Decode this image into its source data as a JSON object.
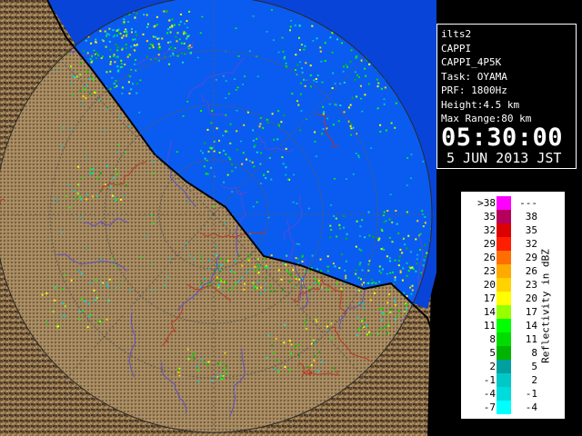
{
  "info": {
    "site": "ilts2",
    "product": "CAPPI",
    "product_code": "CAPPI_4P5K",
    "task": "Task: OYAMA",
    "prf": "PRF: 1800Hz",
    "height": "Height:4.5 km",
    "max_range": "Max Range:80 km",
    "time": "05:30:00",
    "date": "5 JUN 2013 JST"
  },
  "legend": {
    "title": "Reflectivity in dBZ",
    "rows": [
      {
        "lo": ">38",
        "hi": "---",
        "color": "#ff00ff"
      },
      {
        "lo": "35",
        "hi": "38",
        "color": "#b4005a"
      },
      {
        "lo": "32",
        "hi": "35",
        "color": "#dc0000"
      },
      {
        "lo": "29",
        "hi": "32",
        "color": "#ff1e00"
      },
      {
        "lo": "26",
        "hi": "29",
        "color": "#ff6e00"
      },
      {
        "lo": "23",
        "hi": "26",
        "color": "#ffaa00"
      },
      {
        "lo": "20",
        "hi": "23",
        "color": "#ffd200"
      },
      {
        "lo": "17",
        "hi": "20",
        "color": "#ffff00"
      },
      {
        "lo": "14",
        "hi": "17",
        "color": "#96ff00"
      },
      {
        "lo": "11",
        "hi": "14",
        "color": "#00ff00"
      },
      {
        "lo": "8",
        "hi": "11",
        "color": "#00dc00"
      },
      {
        "lo": "5",
        "hi": "8",
        "color": "#00b400"
      },
      {
        "lo": "2",
        "hi": "5",
        "color": "#00a0a0"
      },
      {
        "lo": "-1",
        "hi": "2",
        "color": "#00c8c8"
      },
      {
        "lo": "-4",
        "hi": "-1",
        "color": "#00dcdc"
      },
      {
        "lo": "-7",
        "hi": "-4",
        "color": "#00ffff"
      }
    ]
  },
  "map": {
    "sea_color": "#0a5cf0",
    "outer_sea_color": "#0844d8",
    "land_color": "#8a6d48",
    "land_dark_color": "#4a3a26",
    "river_color": "#5a4ad0",
    "boundary_color": "#c03020",
    "coast_color": "#000000",
    "range_ring_color": "#505050"
  }
}
